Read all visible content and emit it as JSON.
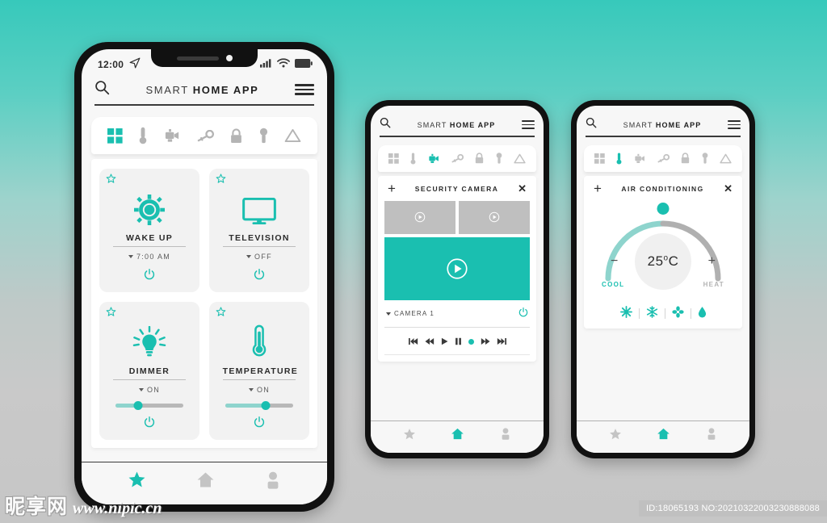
{
  "accent": "#1abfb0",
  "accent_light": "#8ed4cd",
  "gray": "#b4b4b4",
  "phone1": {
    "status": {
      "time": "12:00",
      "location_icon": "send-icon",
      "signal_icon": "signal-icon",
      "wifi_icon": "wifi-icon",
      "battery_icon": "battery-icon"
    },
    "header": {
      "search_icon": "search-icon",
      "title_light": "SMART",
      "title_bold": "HOME APP",
      "menu_icon": "hamburger-menu-icon"
    },
    "toolbar": [
      {
        "name": "grid-icon",
        "active": true
      },
      {
        "name": "thermometer-icon",
        "active": false
      },
      {
        "name": "camera-icon",
        "active": false
      },
      {
        "name": "key-icon",
        "active": false
      },
      {
        "name": "lock-icon",
        "active": false
      },
      {
        "name": "plug-icon",
        "active": false
      },
      {
        "name": "recycle-icon",
        "active": false
      }
    ],
    "tiles": [
      {
        "icon": "sun-icon",
        "name": "WAKE UP",
        "status": "7:00 AM",
        "has_slider": false,
        "favorite": true
      },
      {
        "icon": "television-icon",
        "name": "TELEVISION",
        "status": "OFF",
        "has_slider": false,
        "favorite": true
      },
      {
        "icon": "lightbulb-icon",
        "name": "DIMMER",
        "status": "ON",
        "has_slider": true,
        "slider_pct": 33,
        "favorite": true
      },
      {
        "icon": "thermometer-icon",
        "name": "TEMPERATURE",
        "status": "ON",
        "has_slider": true,
        "slider_pct": 60,
        "favorite": true
      }
    ],
    "nav": [
      {
        "name": "star-icon",
        "active": true
      },
      {
        "name": "home-icon",
        "active": false
      },
      {
        "name": "person-icon",
        "active": false
      }
    ]
  },
  "phone2": {
    "header": {
      "search_icon": "search-icon",
      "title_light": "SMART",
      "title_bold": "HOME APP",
      "menu_icon": "hamburger-menu-icon"
    },
    "toolbar": [
      {
        "name": "grid-icon",
        "active": false
      },
      {
        "name": "thermometer-icon",
        "active": false
      },
      {
        "name": "camera-icon",
        "active": true
      },
      {
        "name": "key-icon",
        "active": false
      },
      {
        "name": "lock-icon",
        "active": false
      },
      {
        "name": "plug-icon",
        "active": false
      },
      {
        "name": "recycle-icon",
        "active": false
      }
    ],
    "panel": {
      "add_label": "+",
      "title": "SECURITY CAMERA",
      "close_label": "✕"
    },
    "thumbs": [
      {
        "name": "camera-thumb-1"
      },
      {
        "name": "camera-thumb-2"
      }
    ],
    "feed": {
      "name": "camera-live-feed",
      "play_icon": "play-circle-icon"
    },
    "camera_label": "CAMERA 1",
    "media_controls": [
      {
        "name": "skip-start-icon"
      },
      {
        "name": "rewind-icon"
      },
      {
        "name": "play-icon"
      },
      {
        "name": "pause-icon"
      },
      {
        "name": "record-icon"
      },
      {
        "name": "fast-forward-icon"
      },
      {
        "name": "skip-end-icon"
      }
    ],
    "nav": [
      {
        "name": "star-icon",
        "active": false
      },
      {
        "name": "home-icon",
        "active": true
      },
      {
        "name": "person-icon",
        "active": false
      }
    ]
  },
  "phone3": {
    "header": {
      "search_icon": "search-icon",
      "title_light": "SMART",
      "title_bold": "HOME APP",
      "menu_icon": "hamburger-menu-icon"
    },
    "toolbar": [
      {
        "name": "grid-icon",
        "active": false
      },
      {
        "name": "thermometer-icon",
        "active": true
      },
      {
        "name": "camera-icon",
        "active": false
      },
      {
        "name": "key-icon",
        "active": false
      },
      {
        "name": "lock-icon",
        "active": false
      },
      {
        "name": "plug-icon",
        "active": false
      },
      {
        "name": "recycle-icon",
        "active": false
      }
    ],
    "panel": {
      "add_label": "+",
      "title": "AIR CONDITIONING",
      "close_label": "✕"
    },
    "thermostat": {
      "temperature": "25",
      "degree": "o",
      "unit": "C",
      "minus_label": "−",
      "plus_label": "+",
      "cool_label": "COOL",
      "heat_label": "HEAT",
      "dial_pct": 50
    },
    "modes": [
      {
        "name": "auto-icon"
      },
      {
        "name": "snowflake-icon"
      },
      {
        "name": "fan-icon"
      },
      {
        "name": "humidity-icon"
      }
    ],
    "nav": [
      {
        "name": "star-icon",
        "active": false
      },
      {
        "name": "home-icon",
        "active": true
      },
      {
        "name": "person-icon",
        "active": false
      }
    ]
  },
  "watermark": {
    "cn": "昵享网",
    "url": "www.nipic.cn",
    "id": "ID:18065193 NO:20210322003230888088"
  }
}
